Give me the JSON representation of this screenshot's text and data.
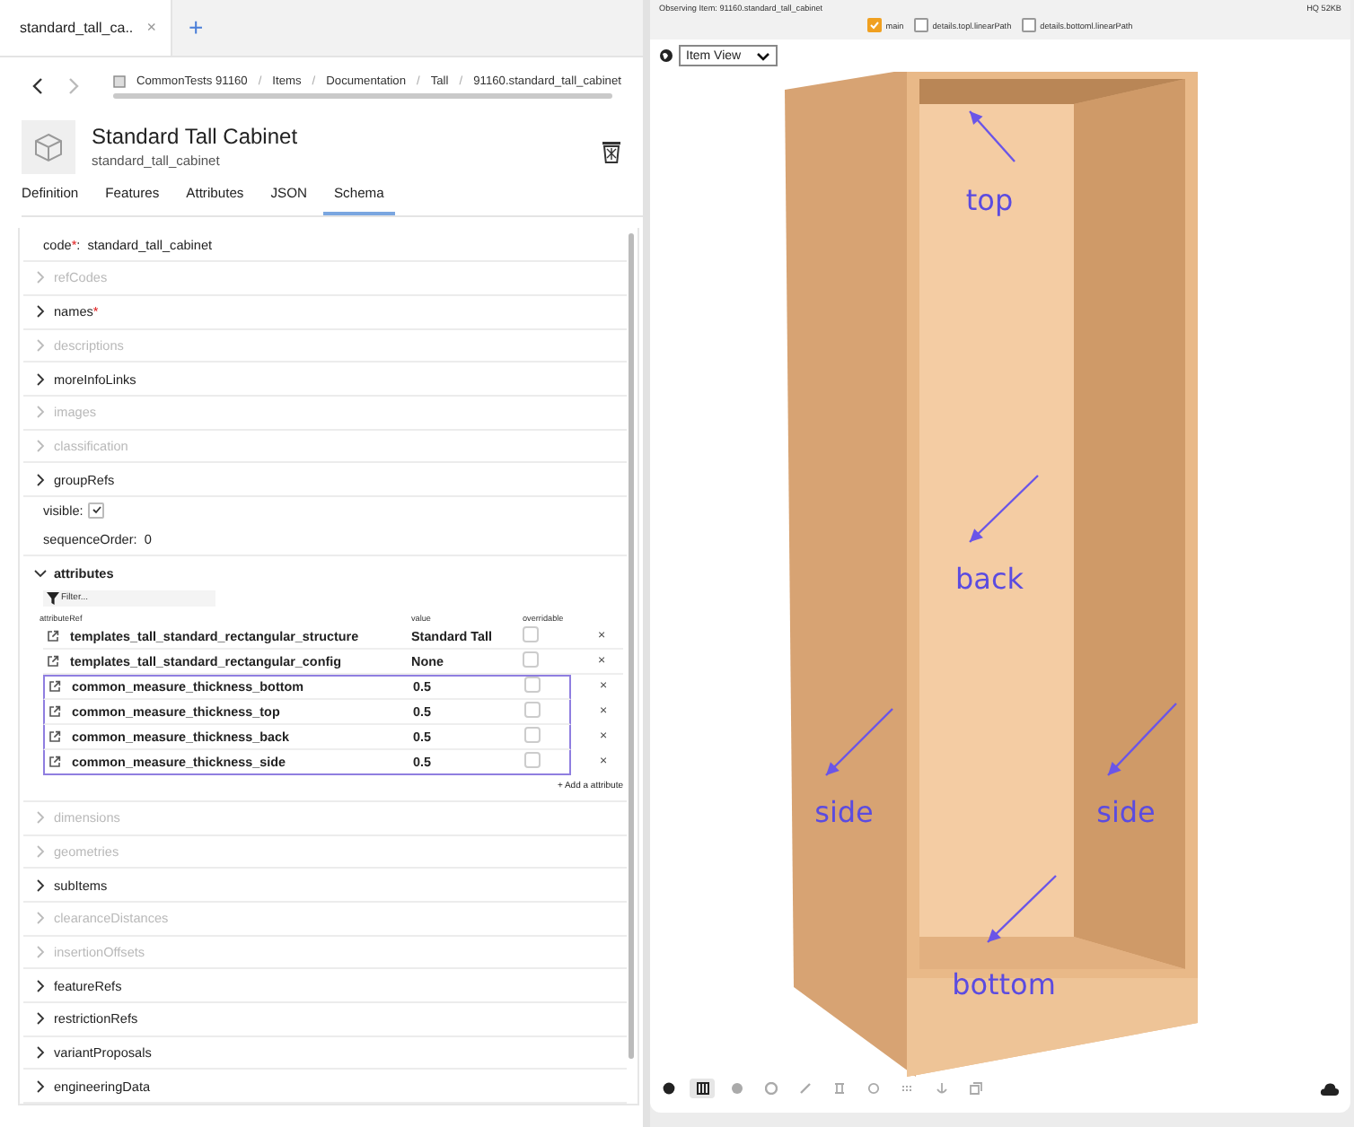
{
  "browser_tab": {
    "title": "standard_tall_ca..",
    "close": "×",
    "new": "+"
  },
  "breadcrumb": [
    "CommonTests 91160",
    "Items",
    "Documentation",
    "Tall",
    "91160.standard_tall_cabinet"
  ],
  "breadcrumb_separator": "/",
  "required_mark": "*",
  "item": {
    "title": "Standard Tall Cabinet",
    "code": "standard_tall_cabinet"
  },
  "tabs": [
    {
      "label": "Definition",
      "selected": false
    },
    {
      "label": "Features",
      "selected": false
    },
    {
      "label": "Attributes",
      "selected": false
    },
    {
      "label": "JSON",
      "selected": false
    },
    {
      "label": "Schema",
      "selected": true
    }
  ],
  "fields": [
    {
      "kind": "value",
      "label": "code",
      "required": true,
      "separator": ":",
      "value": "standard_tall_cabinet"
    },
    {
      "kind": "section",
      "label": "refCodes",
      "disabled": true,
      "expanded": false
    },
    {
      "kind": "section",
      "label": "names",
      "required": true,
      "disabled": false,
      "expanded": false
    },
    {
      "kind": "section",
      "label": "descriptions",
      "disabled": true,
      "expanded": false
    },
    {
      "kind": "section",
      "label": "moreInfoLinks",
      "disabled": false,
      "expanded": false
    },
    {
      "kind": "section",
      "label": "images",
      "disabled": true,
      "expanded": false
    },
    {
      "kind": "section",
      "label": "classification",
      "disabled": true,
      "expanded": false
    },
    {
      "kind": "section",
      "label": "groupRefs",
      "disabled": false,
      "expanded": false
    },
    {
      "kind": "checkbox",
      "label": "visible:",
      "checked": true
    },
    {
      "kind": "value",
      "label": "sequenceOrder:",
      "value": "0"
    },
    {
      "kind": "table",
      "label": "attributes",
      "disabled": false,
      "expanded": true,
      "filter_placeholder": "Filter...",
      "columns": [
        "attributeRef",
        "value",
        "overridable"
      ],
      "remove": "×",
      "add_label": "+ Add a attribute",
      "rows": [
        {
          "name": "templates_tall_standard_rectangular_structure",
          "value": "Standard Tall",
          "overridable": false,
          "highlighted": false
        },
        {
          "name": "templates_tall_standard_rectangular_config",
          "value": "None",
          "overridable": false,
          "highlighted": false
        },
        {
          "name": "common_measure_thickness_bottom",
          "value": "0.5",
          "overridable": false,
          "highlighted": true
        },
        {
          "name": "common_measure_thickness_top",
          "value": "0.5",
          "overridable": false,
          "highlighted": true
        },
        {
          "name": "common_measure_thickness_back",
          "value": "0.5",
          "overridable": false,
          "highlighted": true
        },
        {
          "name": "common_measure_thickness_side",
          "value": "0.5",
          "overridable": false,
          "highlighted": true
        }
      ]
    },
    {
      "kind": "section",
      "label": "dimensions",
      "disabled": true,
      "expanded": false
    },
    {
      "kind": "section",
      "label": "geometries",
      "disabled": true,
      "expanded": false
    },
    {
      "kind": "section",
      "label": "subItems",
      "disabled": false,
      "expanded": false
    },
    {
      "kind": "section",
      "label": "clearanceDistances",
      "disabled": true,
      "expanded": false
    },
    {
      "kind": "section",
      "label": "insertionOffsets",
      "disabled": true,
      "expanded": false
    },
    {
      "kind": "section",
      "label": "featureRefs",
      "disabled": false,
      "expanded": false
    },
    {
      "kind": "section",
      "label": "restrictionRefs",
      "disabled": false,
      "expanded": false
    },
    {
      "kind": "section",
      "label": "variantProposals",
      "disabled": false,
      "expanded": false
    },
    {
      "kind": "section",
      "label": "engineeringData",
      "disabled": false,
      "expanded": false
    }
  ],
  "viewer": {
    "status": "Observing Item: 91160.standard_tall_cabinet",
    "size": "HQ 52KB",
    "layers": [
      {
        "label": "main",
        "checked": true
      },
      {
        "label": "details.topl.linearPath",
        "checked": false
      },
      {
        "label": "details.bottoml.linearPath",
        "checked": false
      }
    ],
    "view_select": "Item View",
    "annotations": [
      {
        "label": "top",
        "kind": "top"
      },
      {
        "label": "back",
        "kind": "back"
      },
      {
        "label": "side",
        "kind": "left"
      },
      {
        "label": "side",
        "kind": "right"
      },
      {
        "label": "bottom",
        "kind": "bottom"
      }
    ],
    "toolbar": [
      {
        "kind": "palette",
        "selected": false
      },
      {
        "kind": "grid",
        "selected": true
      },
      {
        "kind": "disc",
        "selected": false
      },
      {
        "kind": "sphere",
        "selected": false
      },
      {
        "kind": "pen",
        "selected": false
      },
      {
        "kind": "frame",
        "selected": false
      },
      {
        "kind": "ring",
        "selected": false
      },
      {
        "kind": "dots",
        "selected": false
      },
      {
        "kind": "anchor",
        "selected": false
      },
      {
        "kind": "layers",
        "selected": false
      }
    ]
  }
}
